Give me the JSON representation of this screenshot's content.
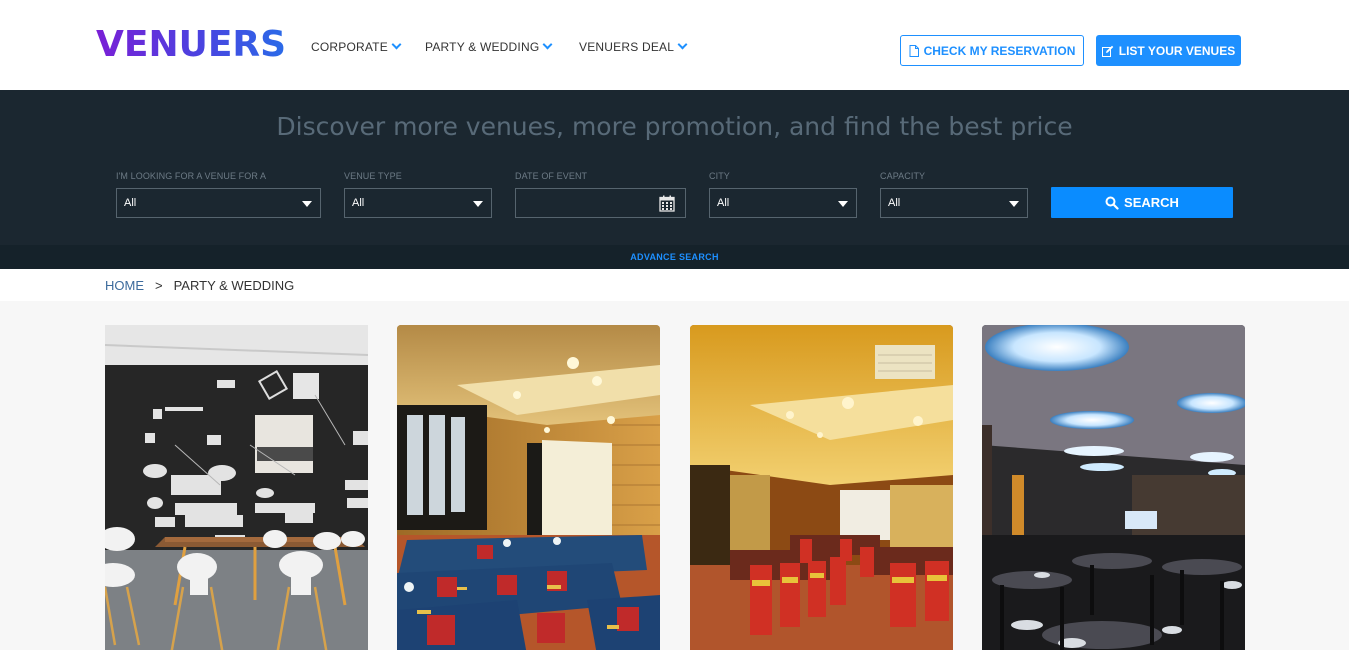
{
  "brand": {
    "name": "VENUERS"
  },
  "nav": {
    "items": [
      {
        "label": "CORPORATE"
      },
      {
        "label": "PARTY & WEDDING"
      },
      {
        "label": "VENUERS DEAL"
      }
    ],
    "check_reservation": "CHECK MY RESERVATION",
    "list_venues": "LIST YOUR VENUES"
  },
  "search": {
    "tagline": "Discover more venues, more promotion, and find the best price",
    "fields": [
      {
        "label": "I'M LOOKING FOR A VENUE FOR A",
        "value": "All"
      },
      {
        "label": "VENUE TYPE",
        "value": "All"
      },
      {
        "label": "DATE OF EVENT",
        "value": ""
      },
      {
        "label": "CITY",
        "value": "All"
      },
      {
        "label": "CAPACITY",
        "value": "All"
      }
    ],
    "button": "SEARCH",
    "advance": "ADVANCE SEARCH"
  },
  "breadcrumb": {
    "home": "HOME",
    "separator": ">",
    "current": "PARTY & WEDDING"
  },
  "colors": {
    "accent": "#1e90ff",
    "band": "#1b2730",
    "brand_start": "#7a1fd6",
    "brand_end": "#2a6be8"
  },
  "venues": [
    {
      "image": "coworking room with black logo wall"
    },
    {
      "image": "classroom meeting room with blue tables"
    },
    {
      "image": "banquet hall with red chairs"
    },
    {
      "image": "dark restaurant with round ceiling lights"
    }
  ]
}
